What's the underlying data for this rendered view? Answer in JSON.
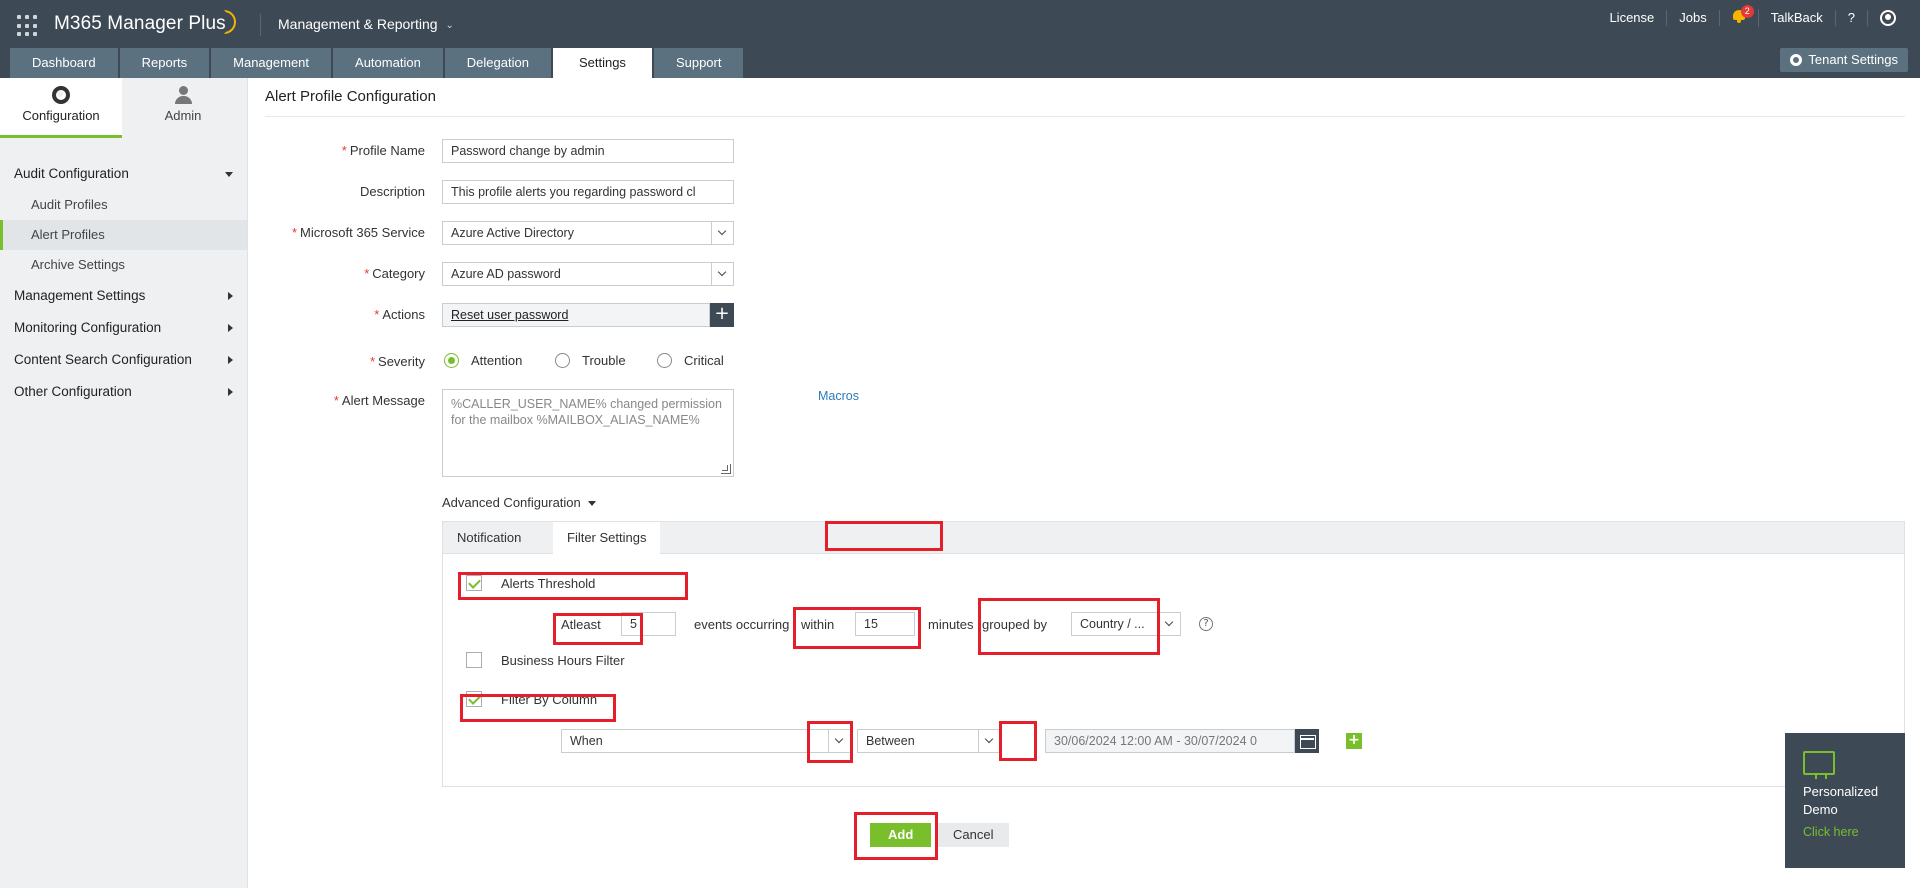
{
  "app": {
    "title": "M365 Manager Plus",
    "workspace": "Management & Reporting"
  },
  "toplinks": {
    "license": "License",
    "jobs": "Jobs",
    "notif_count": "2",
    "talkback": "TalkBack",
    "help": "?"
  },
  "nav": {
    "tabs": [
      "Dashboard",
      "Reports",
      "Management",
      "Automation",
      "Delegation",
      "Settings",
      "Support"
    ],
    "active": "Settings"
  },
  "tenant_settings": "Tenant Settings",
  "sidebar": {
    "tabs": [
      "Configuration",
      "Admin"
    ],
    "menu": {
      "audit_config": "Audit Configuration",
      "audit_profiles": "Audit Profiles",
      "alert_profiles": "Alert Profiles",
      "archive_settings": "Archive Settings",
      "management_settings": "Management Settings",
      "monitoring_config": "Monitoring Configuration",
      "content_search_config": "Content Search Configuration",
      "other_config": "Other Configuration"
    }
  },
  "page": {
    "title": "Alert Profile Configuration"
  },
  "form": {
    "profile_name_label": "Profile Name",
    "profile_name_value": "Password change by admin",
    "description_label": "Description",
    "description_value": "This profile alerts you regarding password cl",
    "service_label": "Microsoft 365 Service",
    "service_value": "Azure Active Directory",
    "category_label": "Category",
    "category_value": "Azure AD password",
    "actions_label": "Actions",
    "actions_value": "Reset user password",
    "add_action": "+",
    "severity_label": "Severity",
    "severity_options": [
      "Attention",
      "Trouble",
      "Critical"
    ],
    "severity_selected": "Attention",
    "alert_message_label": "Alert Message",
    "alert_message_value": "%CALLER_USER_NAME% changed permission for the mailbox %MAILBOX_ALIAS_NAME%",
    "macros_link": "Macros"
  },
  "advanced": {
    "label": "Advanced Configuration",
    "tabs": [
      "Notification",
      "Filter Settings"
    ],
    "active_tab": "Filter Settings",
    "alerts_threshold": {
      "label": "Alerts Threshold",
      "checked": true,
      "atleast_label": "Atleast",
      "atleast_value": "5",
      "events_label": "events occurring",
      "within_label": "within",
      "within_value": "15",
      "minutes_label": "minutes",
      "grouped_label": "grouped by",
      "grouped_value": "Country / ...",
      "help": "?"
    },
    "business_hours": {
      "label": "Business Hours Filter",
      "checked": false
    },
    "filter_by_column": {
      "label": "Filter By Column",
      "checked": true,
      "column_value": "When",
      "operator_value": "Between",
      "date_range_value": "30/06/2024 12:00 AM - 30/07/2024 0",
      "add_row": "+"
    }
  },
  "buttons": {
    "add": "Add",
    "cancel": "Cancel"
  },
  "demo": {
    "title": "Personalized Demo",
    "link": "Click here"
  },
  "colors": {
    "topbar": "#3d4a55",
    "accent_green": "#78bf2b",
    "highlight_red": "#e41e2b",
    "link_blue": "#2b7bb9"
  }
}
